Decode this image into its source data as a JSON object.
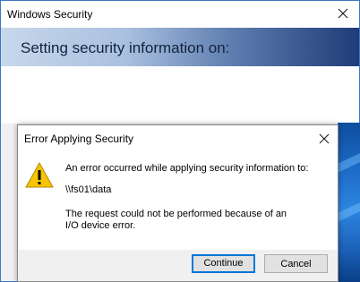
{
  "outer_window": {
    "title": "Windows Security",
    "banner_text": "Setting security information on:"
  },
  "dialog": {
    "title": "Error Applying Security",
    "message_line1": "An error occurred while applying security information to:",
    "path": "\\\\fs01\\data",
    "message_line2": "The request could not be performed because of an I/O device error.",
    "continue_label": "Continue",
    "cancel_label": "Cancel",
    "icon": "warning-icon"
  },
  "colors": {
    "accent": "#0078d7",
    "warning": "#f6c400"
  }
}
